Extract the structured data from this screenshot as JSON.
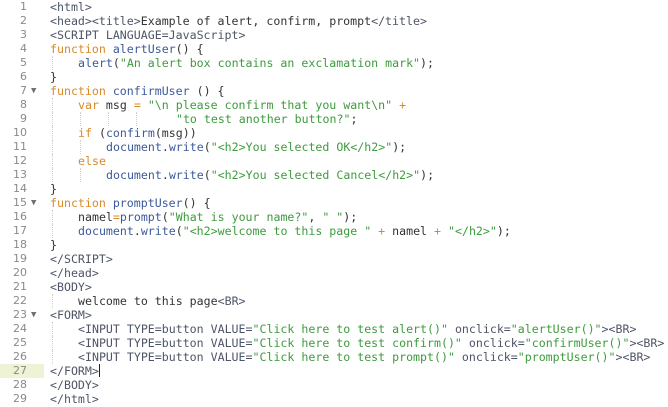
{
  "editor": {
    "active_line": 27,
    "colors": {
      "tag": "#4e5566",
      "keyword": "#d88a2a",
      "identifier": "#3c5a9a",
      "string": "#3e9b3e",
      "plain": "#333333",
      "active_gutter": "#eef3d6"
    },
    "lines": [
      {
        "n": "1",
        "i": 0,
        "tk": [
          [
            "<html>",
            "t"
          ]
        ]
      },
      {
        "n": "2",
        "i": 0,
        "tk": [
          [
            "<head><title>",
            "t"
          ],
          [
            "Example of alert, confirm, prompt",
            "p"
          ],
          [
            "</title>",
            "t"
          ]
        ]
      },
      {
        "n": "3",
        "i": 0,
        "tk": [
          [
            "<SCRIPT LANGUAGE=JavaScript>",
            "t"
          ]
        ]
      },
      {
        "n": "4",
        "i": 0,
        "tk": [
          [
            "function ",
            "k"
          ],
          [
            "alertUser",
            "f"
          ],
          [
            "() {",
            "p"
          ]
        ]
      },
      {
        "n": "5",
        "i": 1,
        "tk": [
          [
            "alert",
            "f"
          ],
          [
            "(",
            "p"
          ],
          [
            "\"An alert box contains an exclamation mark\"",
            "s"
          ],
          [
            ");",
            "p"
          ]
        ]
      },
      {
        "n": "6",
        "i": 0,
        "tk": [
          [
            "}",
            "p"
          ]
        ]
      },
      {
        "n": "7",
        "i": 0,
        "fold": true,
        "tk": [
          [
            "function ",
            "k"
          ],
          [
            "confirmUser",
            "f"
          ],
          [
            " () {",
            "p"
          ]
        ]
      },
      {
        "n": "8",
        "i": 1,
        "tk": [
          [
            "var ",
            "k"
          ],
          [
            "msg ",
            "p"
          ],
          [
            "= ",
            "o"
          ],
          [
            "\"\\n please confirm that you want\\n\" ",
            "s"
          ],
          [
            "+",
            "o"
          ]
        ]
      },
      {
        "n": "9",
        "i": 4,
        "pad": "  ",
        "tk": [
          [
            "\"to test another button?\"",
            "s"
          ],
          [
            ";",
            "p"
          ]
        ]
      },
      {
        "n": "10",
        "i": 1,
        "tk": [
          [
            "if ",
            "k"
          ],
          [
            "(",
            "p"
          ],
          [
            "confirm",
            "f"
          ],
          [
            "(msg))",
            "p"
          ]
        ]
      },
      {
        "n": "11",
        "i": 2,
        "tk": [
          [
            "document",
            "f"
          ],
          [
            ".",
            "p"
          ],
          [
            "write",
            "f"
          ],
          [
            "(",
            "p"
          ],
          [
            "\"<h2>You selected OK</h2>\"",
            "s"
          ],
          [
            ");",
            "p"
          ]
        ]
      },
      {
        "n": "12",
        "i": 1,
        "tk": [
          [
            "else",
            "k"
          ]
        ]
      },
      {
        "n": "13",
        "i": 2,
        "tk": [
          [
            "document",
            "f"
          ],
          [
            ".",
            "p"
          ],
          [
            "write",
            "f"
          ],
          [
            "(",
            "p"
          ],
          [
            "\"<h2>You selected Cancel</h2>\"",
            "s"
          ],
          [
            ");",
            "p"
          ]
        ]
      },
      {
        "n": "14",
        "i": 0,
        "tk": [
          [
            "}",
            "p"
          ]
        ]
      },
      {
        "n": "15",
        "i": 0,
        "fold": true,
        "tk": [
          [
            "function ",
            "k"
          ],
          [
            "promptUser",
            "f"
          ],
          [
            "() {",
            "p"
          ]
        ]
      },
      {
        "n": "16",
        "i": 1,
        "tk": [
          [
            "namel",
            "p"
          ],
          [
            "=",
            "o"
          ],
          [
            "prompt",
            "f"
          ],
          [
            "(",
            "p"
          ],
          [
            "\"What is your name?\"",
            "s"
          ],
          [
            ", ",
            "p"
          ],
          [
            "\" \"",
            "s"
          ],
          [
            ");",
            "p"
          ]
        ]
      },
      {
        "n": "17",
        "i": 1,
        "tk": [
          [
            "document",
            "f"
          ],
          [
            ".",
            "p"
          ],
          [
            "write",
            "f"
          ],
          [
            "(",
            "p"
          ],
          [
            "\"<h2>welcome to this page \" ",
            "s"
          ],
          [
            "+ ",
            "o"
          ],
          [
            "namel ",
            "p"
          ],
          [
            "+ ",
            "o"
          ],
          [
            "\"</h2>\"",
            "s"
          ],
          [
            ");",
            "p"
          ]
        ]
      },
      {
        "n": "18",
        "i": 0,
        "tk": [
          [
            "}",
            "p"
          ]
        ]
      },
      {
        "n": "19",
        "i": 0,
        "tk": [
          [
            "</SCRIPT>",
            "t"
          ]
        ]
      },
      {
        "n": "20",
        "i": 0,
        "tk": [
          [
            "</head>",
            "t"
          ]
        ]
      },
      {
        "n": "21",
        "i": 0,
        "tk": [
          [
            "<BODY>",
            "t"
          ]
        ]
      },
      {
        "n": "22",
        "i": 1,
        "tk": [
          [
            "welcome to this page",
            "p"
          ],
          [
            "<BR>",
            "t"
          ]
        ]
      },
      {
        "n": "23",
        "i": 0,
        "fold": true,
        "tk": [
          [
            "<FORM>",
            "t"
          ]
        ]
      },
      {
        "n": "24",
        "i": 1,
        "tk": [
          [
            "<INPUT TYPE=button VALUE=",
            "t"
          ],
          [
            "\"Click here to test alert()\"",
            "s"
          ],
          [
            " onclick=",
            "t"
          ],
          [
            "\"alertUser()\"",
            "s"
          ],
          [
            "><BR>",
            "t"
          ]
        ]
      },
      {
        "n": "25",
        "i": 1,
        "tk": [
          [
            "<INPUT TYPE=button VALUE=",
            "t"
          ],
          [
            "\"Click here to test confirm()\"",
            "s"
          ],
          [
            " onclick=",
            "t"
          ],
          [
            "\"confirmUser()\"",
            "s"
          ],
          [
            "><BR>",
            "t"
          ]
        ]
      },
      {
        "n": "26",
        "i": 1,
        "tk": [
          [
            "<INPUT TYPE=button VALUE=",
            "t"
          ],
          [
            "\"Click here to test prompt()\"",
            "s"
          ],
          [
            " onclick=",
            "t"
          ],
          [
            "\"promptUser()\"",
            "s"
          ],
          [
            "><BR>",
            "t"
          ]
        ]
      },
      {
        "n": "27",
        "i": 0,
        "tk": [
          [
            "</FORM>",
            "t"
          ]
        ]
      },
      {
        "n": "28",
        "i": 0,
        "tk": [
          [
            "</BODY>",
            "t"
          ]
        ]
      },
      {
        "n": "29",
        "i": 0,
        "tk": [
          [
            "</html>",
            "t"
          ]
        ]
      }
    ]
  }
}
